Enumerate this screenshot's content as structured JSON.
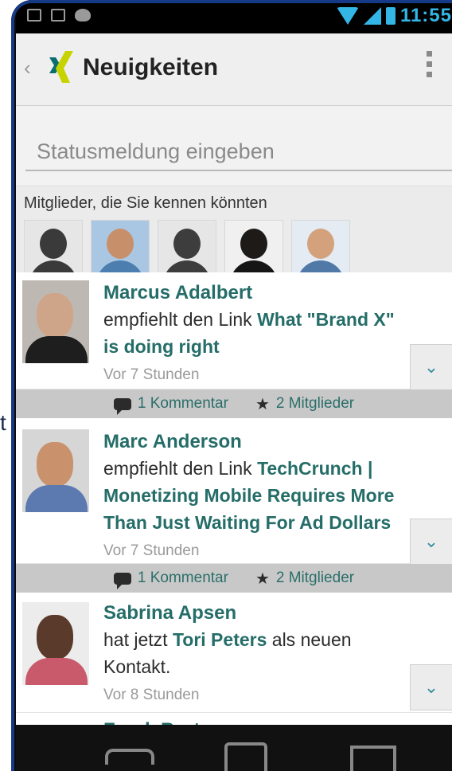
{
  "stray_text": "t",
  "statusbar": {
    "time": "11:55"
  },
  "actionbar": {
    "back_glyph": "‹",
    "title": "Neuigkeiten"
  },
  "status": {
    "placeholder": "Statusmeldung eingeben"
  },
  "suggestions": {
    "title": "Mitglieder, die Sie kennen könnten"
  },
  "feed": {
    "items": [
      {
        "name": "Marcus Adalbert",
        "text_prefix": "empfiehlt den Link",
        "link": "What \"Brand X\" is doing right",
        "time": "Vor 7 Stunden",
        "comments": "1 Kommentar",
        "members": "2 Mitglieder"
      },
      {
        "name": "Marc Anderson",
        "text_prefix": "empfiehlt den Link",
        "link": "TechCrunch | Monetizing Mobile Requires More Than Just Waiting For Ad Dollars",
        "time": "Vor 7 Stunden",
        "comments": "1 Kommentar",
        "members": "2 Mitglieder"
      },
      {
        "name": "Sabrina Apsen",
        "text_prefix": "hat jetzt",
        "contact": "Tori Peters",
        "text_suffix": "als neuen Kontakt.",
        "time": "Vor 8 Stunden"
      },
      {
        "name": "Frank Burten"
      }
    ]
  },
  "colors": {
    "accent": "#256d68",
    "status_blue": "#33b5e5",
    "frame": "#163a86"
  },
  "icons": [
    "back-icon",
    "xing-logo-icon",
    "overflow-menu-icon",
    "comment-icon",
    "star-icon",
    "chevron-down-icon",
    "nav-back-icon",
    "nav-home-icon",
    "nav-recent-icon"
  ]
}
